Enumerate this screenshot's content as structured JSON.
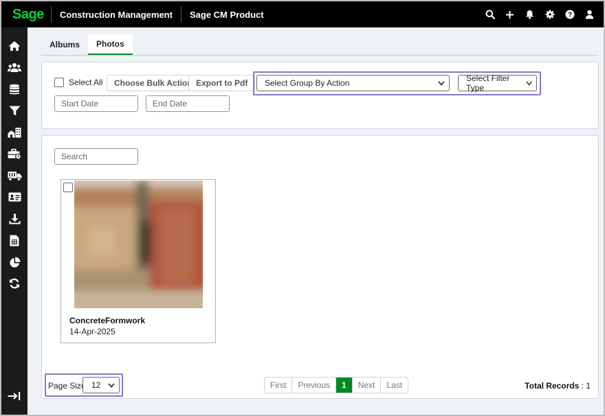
{
  "brand": {
    "logo": "Sage",
    "app_name": "Construction Management",
    "product": "Sage CM Product",
    "accent": "#00d639"
  },
  "top_icons": [
    "search-icon",
    "plus-icon",
    "bell-icon",
    "gear-icon",
    "help-icon",
    "user-icon"
  ],
  "sidebar": {
    "items": [
      "home-icon",
      "users-icon",
      "database-icon",
      "filter-icon",
      "buildings-icon",
      "toolbox-icon",
      "truck-icon",
      "id-card-icon",
      "download-icon",
      "spreadsheet-icon",
      "pie-chart-icon",
      "sync-icon"
    ],
    "collapse": "collapse-icon"
  },
  "tabs": {
    "albums": "Albums",
    "photos": "Photos",
    "active": "Photos"
  },
  "toolbar": {
    "select_all": "Select All",
    "bulk_action": "Choose Bulk Action",
    "export_pdf": "Export to Pdf",
    "group_by": "Select Group By Action",
    "filter_type": "Select Filter Type",
    "start_date_placeholder": "Start Date",
    "end_date_placeholder": "End Date"
  },
  "search": {
    "placeholder": "Search"
  },
  "photos": [
    {
      "title": "ConcreteFormwork",
      "date": "14-Apr-2025"
    }
  ],
  "pagination": {
    "page_size_label": "Page Size",
    "page_size": "12",
    "first": "First",
    "previous": "Previous",
    "current": "1",
    "next": "Next",
    "last": "Last",
    "total_label": "Total Records",
    "total_sep": " : ",
    "total_value": "1"
  },
  "colors": {
    "active_green": "#008a21",
    "highlight_purple": "#8e72c8",
    "topbar": "#000000",
    "sidebar": "#1b1b1b"
  }
}
